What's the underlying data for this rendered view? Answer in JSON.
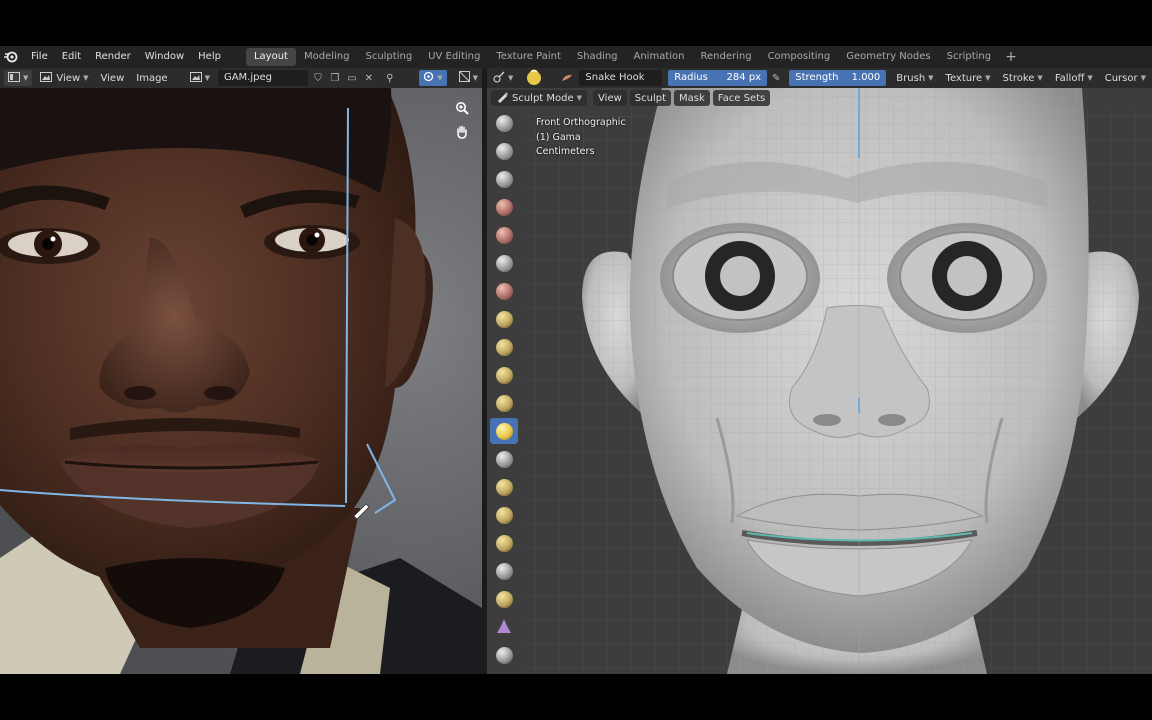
{
  "menu": [
    "File",
    "Edit",
    "Render",
    "Window",
    "Help"
  ],
  "workspaces": [
    {
      "label": "Layout",
      "active": true
    },
    {
      "label": "Modeling",
      "active": false
    },
    {
      "label": "Sculpting",
      "active": false
    },
    {
      "label": "UV Editing",
      "active": false
    },
    {
      "label": "Texture Paint",
      "active": false
    },
    {
      "label": "Shading",
      "active": false
    },
    {
      "label": "Animation",
      "active": false
    },
    {
      "label": "Rendering",
      "active": false
    },
    {
      "label": "Compositing",
      "active": false
    },
    {
      "label": "Geometry Nodes",
      "active": false
    },
    {
      "label": "Scripting",
      "active": false
    }
  ],
  "image_editor": {
    "view_menu": "View",
    "view_menu2": "View",
    "image_menu": "Image",
    "image_name": "GAM.jpeg"
  },
  "tool_settings": {
    "brush_name": "Snake Hook",
    "radius_label": "Radius",
    "radius_value": "284 px",
    "strength_label": "Strength",
    "strength_value": "1.000",
    "dropdowns": [
      "Brush",
      "Texture",
      "Stroke",
      "Falloff",
      "Cursor"
    ]
  },
  "viewport_header": {
    "mode": "Sculpt Mode",
    "menus": [
      "View",
      "Sculpt",
      "Mask",
      "Face Sets"
    ]
  },
  "viewport_info": {
    "view": "Front Orthographic",
    "object": "(1) Gama",
    "units": "Centimeters"
  },
  "colors": {
    "accent": "#4772b3",
    "annotation_line": "#7fb6e6",
    "mesh_wire": "#9aa5a6"
  }
}
